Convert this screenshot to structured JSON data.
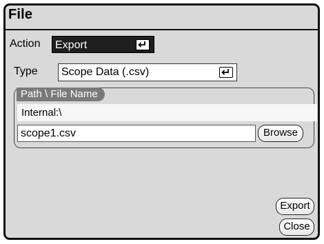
{
  "dialog": {
    "title": "File"
  },
  "action": {
    "label": "Action",
    "value": "Export"
  },
  "type": {
    "label": "Type",
    "value": "Scope Data (.csv)"
  },
  "path_group": {
    "label": "Path \\ File Name",
    "path": "Internal:\\",
    "filename": "scope1.csv",
    "browse_label": "Browse"
  },
  "buttons": {
    "export_label": "Export",
    "close_label": "Close"
  },
  "colors": {
    "panel_bg": "#d9d9d9",
    "dark_select_bg": "#1e1e1e",
    "group_tab_bg": "#7a7a7a"
  }
}
